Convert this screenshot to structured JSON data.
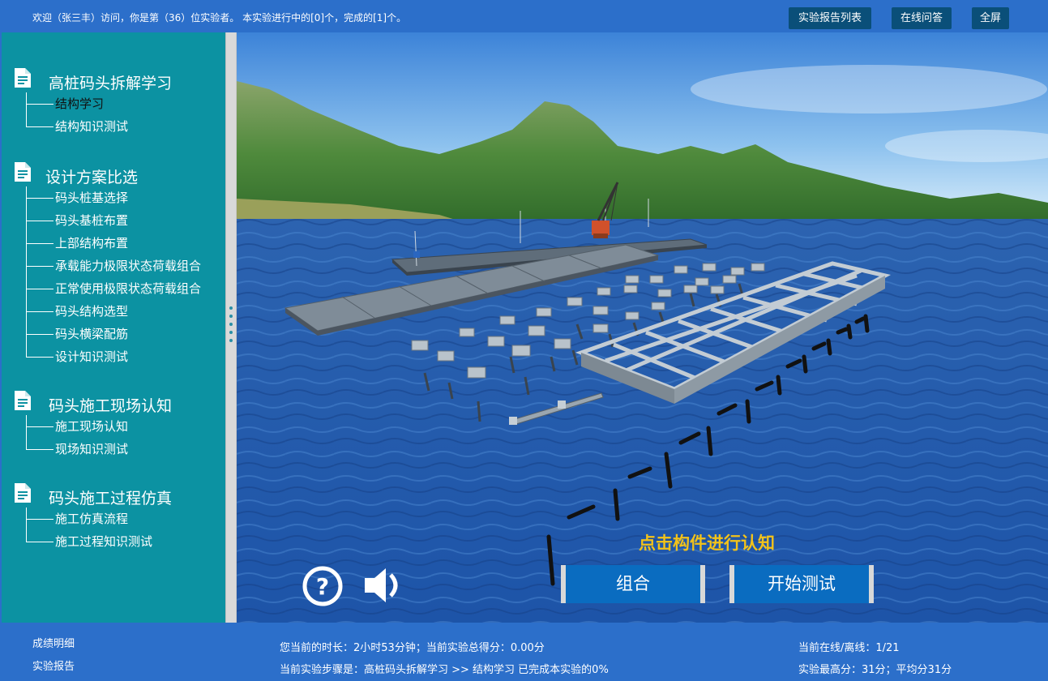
{
  "header": {
    "welcome": "欢迎（张三丰）访问，你是第（36）位实验者。 本实验进行中的[0]个，完成的[1]个。",
    "btn_report_list": "实验报告列表",
    "btn_qa": "在线问答",
    "btn_fullscreen": "全屏"
  },
  "sidebar": {
    "sections": [
      {
        "title": "高桩码头拆解学习",
        "items": [
          "结构学习",
          "结构知识测试"
        ]
      },
      {
        "title": "设计方案比选",
        "items": [
          "码头桩基选择",
          "码头基桩布置",
          "上部结构布置",
          "承载能力极限状态荷载组合",
          "正常使用极限状态荷载组合",
          "码头结构选型",
          "码头横梁配筋",
          "设计知识测试"
        ]
      },
      {
        "title": "码头施工现场认知",
        "items": [
          "施工现场认知",
          "现场知识测试"
        ]
      },
      {
        "title": "码头施工过程仿真",
        "items": [
          "施工仿真流程",
          "施工过程知识测试"
        ]
      }
    ],
    "active_item": "结构学习"
  },
  "viewport": {
    "hint": "点击构件进行认知",
    "btn_combine": "组合",
    "btn_start_test": "开始测试",
    "icons": [
      "help-icon",
      "sound-icon"
    ]
  },
  "footer": {
    "score_detail": "成绩明细",
    "lab_report": "实验报告",
    "duration": "您当前的时长：2小时53分钟；当前实验总得分：0.00分",
    "step": "当前实验步骤是：高桩码头拆解学习 >> 结构学习 已完成本实验的0%",
    "online": "当前在线/离线：1/21",
    "scores": "实验最高分：31分；平均分31分"
  },
  "colors": {
    "bar_blue": "#2c6fca",
    "sidebar_teal": "#0c92a2",
    "button_dark": "#0a4f79",
    "hint_yellow": "#f2c21a",
    "action_blue": "#0a6cc0"
  }
}
